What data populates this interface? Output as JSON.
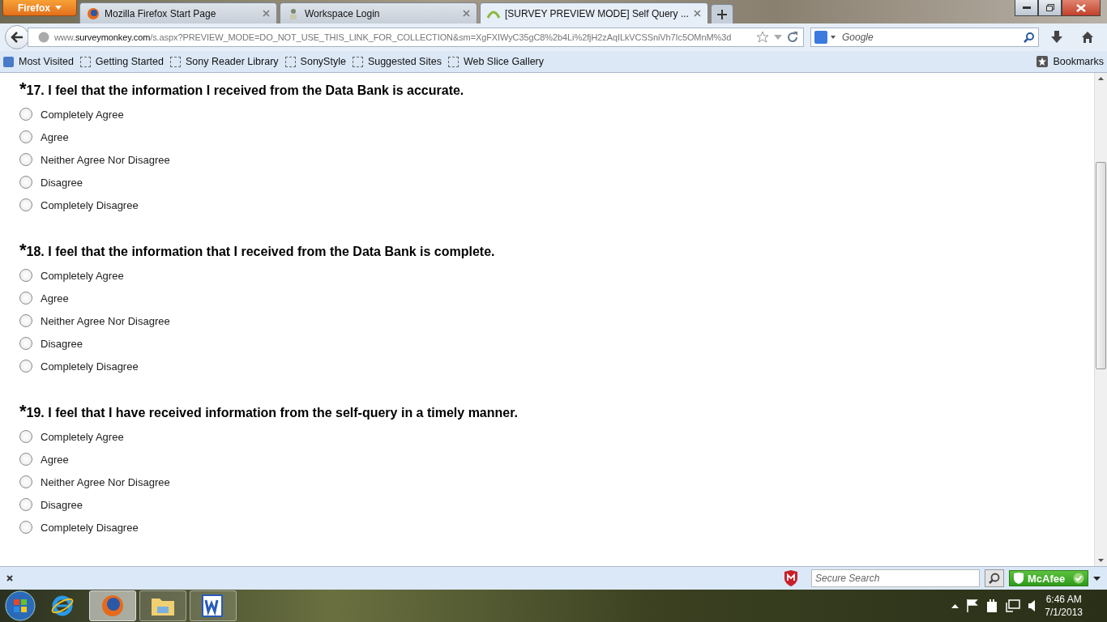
{
  "browser": {
    "menu_button": "Firefox",
    "tabs": [
      {
        "title": "Mozilla Firefox Start Page",
        "selected": false
      },
      {
        "title": "Workspace Login",
        "selected": false
      },
      {
        "title": "[SURVEY PREVIEW MODE] Self Query ...",
        "selected": true
      }
    ],
    "url": {
      "prefix": "www.",
      "domain": "surveymonkey.com",
      "path": "/s.aspx?PREVIEW_MODE=DO_NOT_USE_THIS_LINK_FOR_COLLECTION&sm=XgFXIWyC35gC8%2b4Li%2fjH2zAqILkVCSSniVh7Ic5OMnM%3d"
    },
    "search": {
      "placeholder": "Google"
    },
    "bookmarks": [
      "Most Visited",
      "Getting Started",
      "Sony Reader Library",
      "SonyStyle",
      "Suggested Sites",
      "Web Slice Gallery"
    ],
    "bookmarks_menu": "Bookmarks"
  },
  "questions": [
    {
      "marker": "*",
      "number": "17.",
      "text": "I feel that the information I received from the Data Bank is accurate.",
      "options": [
        {
          "label": "Completely Agree",
          "selected": false
        },
        {
          "label": "Agree",
          "selected": false
        },
        {
          "label": "Neither Agree Nor Disagree",
          "selected": false
        },
        {
          "label": "Disagree",
          "selected": false
        },
        {
          "label": "Completely Disagree",
          "selected": false
        }
      ]
    },
    {
      "marker": "*",
      "number": "18.",
      "text": "I feel that the information that I received from the Data Bank is complete.",
      "options": [
        {
          "label": "Completely Agree",
          "selected": false
        },
        {
          "label": "Agree",
          "selected": false
        },
        {
          "label": "Neither Agree Nor Disagree",
          "selected": false
        },
        {
          "label": "Disagree",
          "selected": false
        },
        {
          "label": "Completely Disagree",
          "selected": false
        }
      ]
    },
    {
      "marker": "*",
      "number": "19.",
      "text": "I feel that I have received information from the self-query in a timely manner.",
      "options": [
        {
          "label": "Completely Agree",
          "selected": false
        },
        {
          "label": "Agree",
          "selected": false
        },
        {
          "label": "Neither Agree Nor Disagree",
          "selected": false
        },
        {
          "label": "Disagree",
          "selected": false
        },
        {
          "label": "Completely Disagree",
          "selected": false
        }
      ]
    }
  ],
  "addon_bar": {
    "search_placeholder": "Secure Search",
    "brand": "McAfee"
  },
  "taskbar": {
    "time": "6:46 AM",
    "date": "7/1/2013"
  }
}
